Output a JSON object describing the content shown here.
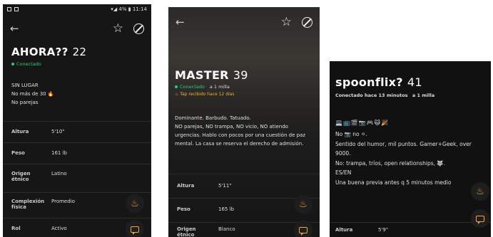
{
  "profiles": [
    {
      "status_time": "11:14",
      "status_battery": "4%",
      "name": "AHORA??",
      "age": "22",
      "online": "Conectado",
      "bio": [
        "SIN LUGAR",
        "No más de 30 🔥",
        "No parejas"
      ],
      "stats": [
        {
          "label": "Altura",
          "value": "5'10\""
        },
        {
          "label": "Peso",
          "value": "161 lb"
        },
        {
          "label": "Origen étnico",
          "value": "Latino"
        },
        {
          "label": "Complexión física",
          "value": "Promedio"
        },
        {
          "label": "Rol",
          "value": "Activo"
        }
      ]
    },
    {
      "name": "MASTER",
      "age": "39",
      "online": "Conectado",
      "distance": "a 1 milla",
      "tap": "Tap recibido hace 12 días",
      "bio": [
        "Dominante. Barbudo. Tatuado.",
        "NO parejas, NO trampa, NO vicio, NO atiendo urgencias. Hablo con pocos por una cuestión de paz mental. La casa se reserva el derecho de admisión."
      ],
      "stats": [
        {
          "label": "Altura",
          "value": "5'11\""
        },
        {
          "label": "Peso",
          "value": "165 lb"
        },
        {
          "label": "Origen étnico",
          "value": "Blanco"
        }
      ]
    },
    {
      "name": "spoonflix?",
      "age": "41",
      "online": "Conectado hace 13 minutos",
      "distance": "a 1 milla",
      "emojis": "💻📺🎬📷🎮🐱🎉",
      "bio": [
        "No 📷 no ⚪.",
        "Sentido del humor, mil puntos. Gamer+Geek, over 9000.",
        "No: trampa, tríos, open relationships, 🐺.",
        "ES/EN",
        "Una buena previa antes q 5 minutos medio"
      ],
      "stats": [
        {
          "label": "Altura",
          "value": "5'9\""
        }
      ]
    }
  ],
  "colors": {
    "online": "#2ecc71",
    "accent": "#f2a93b",
    "tap": "#f0b429"
  },
  "icons": [
    "back-arrow-icon",
    "star-icon",
    "block-icon",
    "flame-icon",
    "chat-icon"
  ]
}
